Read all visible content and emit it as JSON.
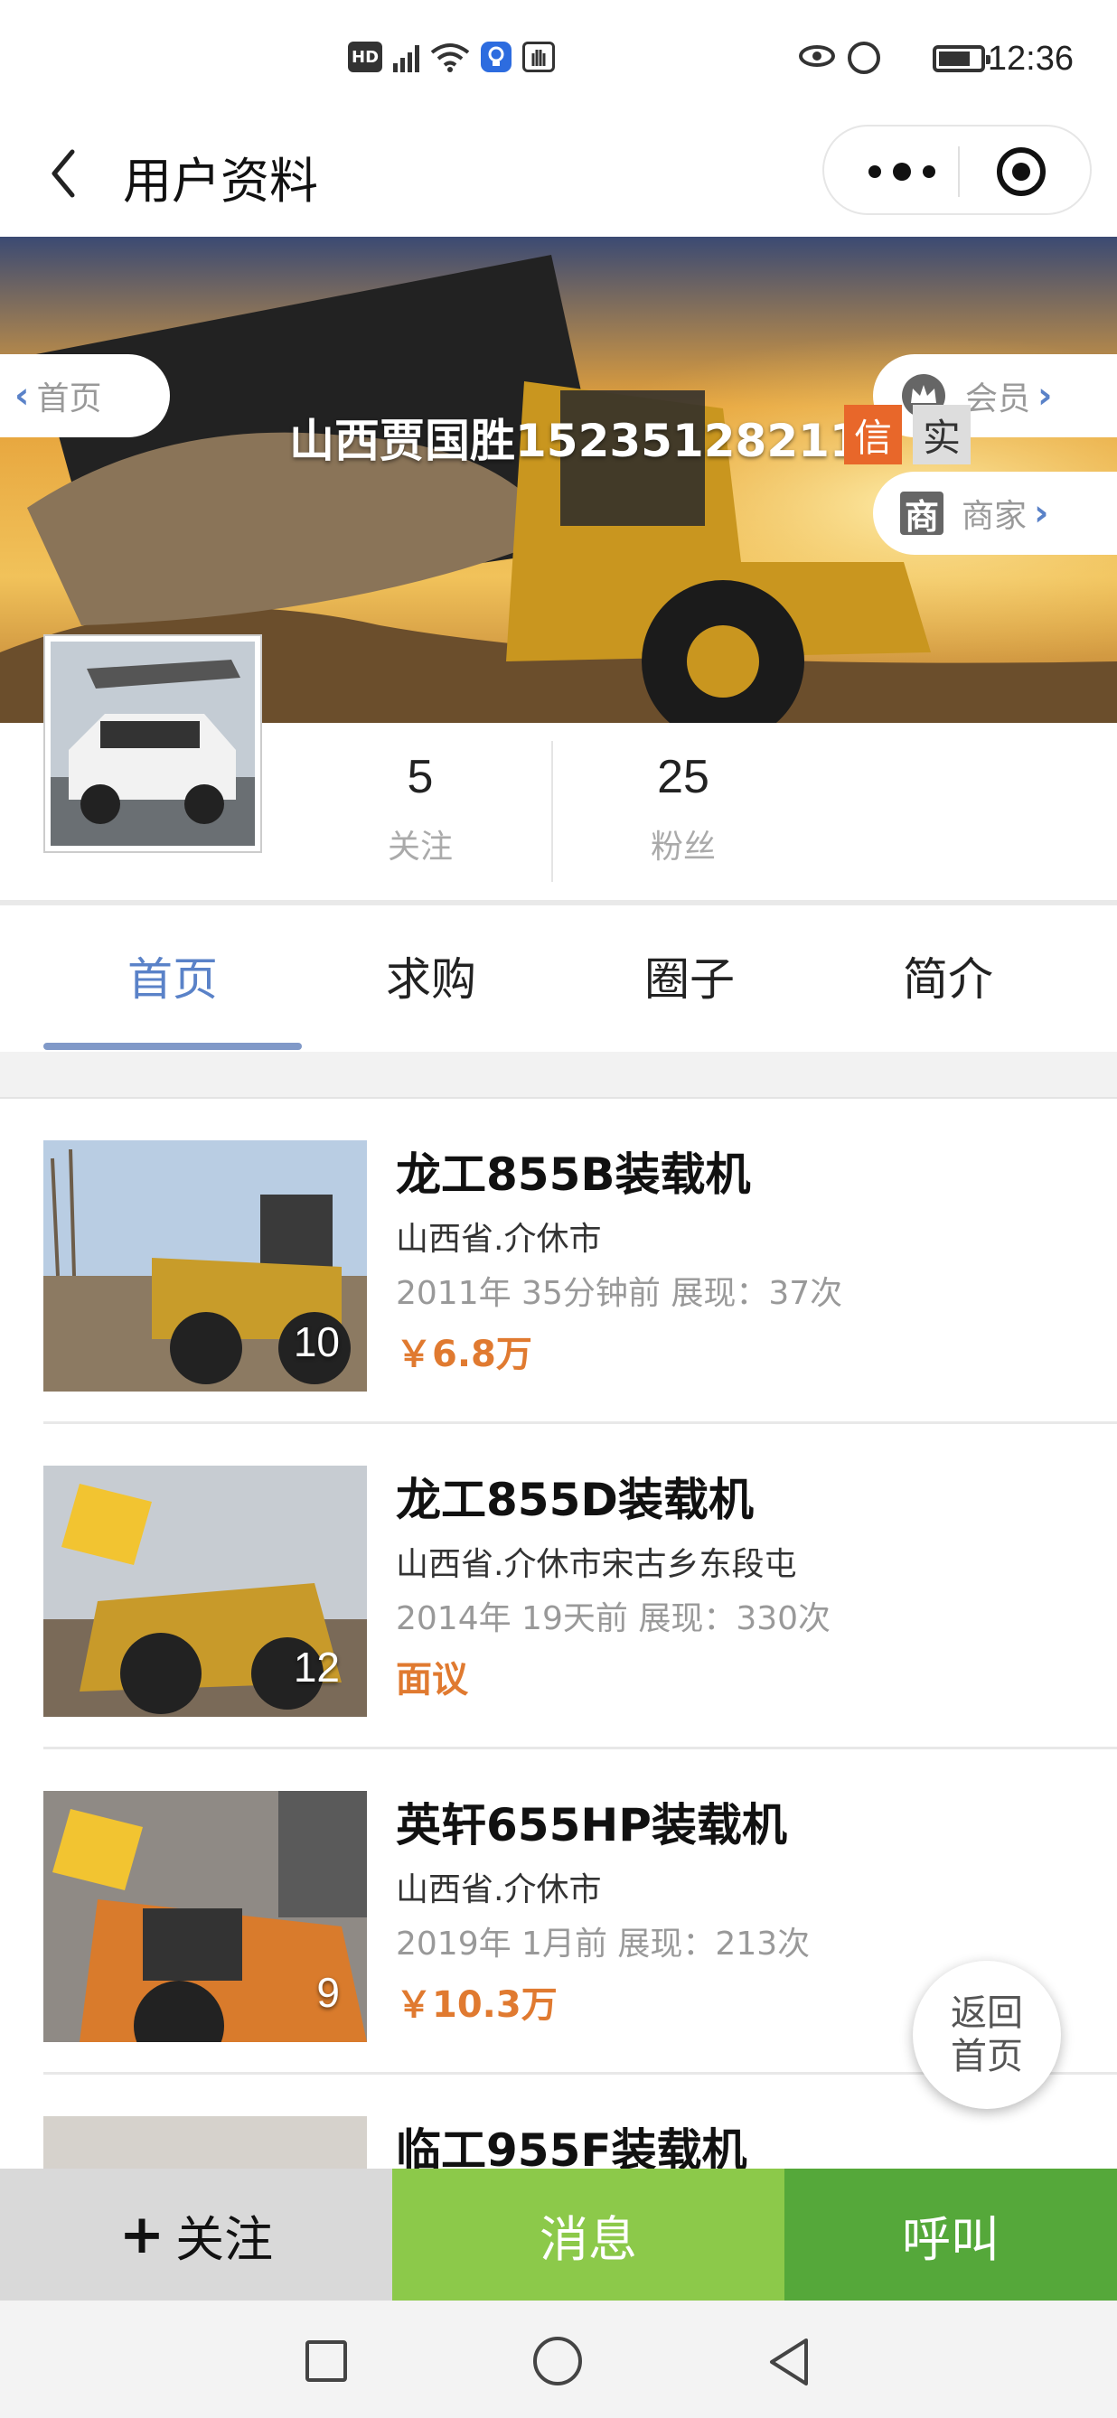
{
  "status_bar": {
    "time": "12:36",
    "left_icons": [
      "HD",
      "5G"
    ]
  },
  "title_bar": {
    "title": "用户资料"
  },
  "hero": {
    "home_link": "首页",
    "vip_link": "会员",
    "merchant_link": "商家",
    "merchant_icon_char": "商",
    "username": "山西贾国胜15235128211",
    "badge_credit": "信",
    "badge_verified": "实"
  },
  "stats": {
    "following": {
      "value": "5",
      "label": "关注"
    },
    "fans": {
      "value": "25",
      "label": "粉丝"
    }
  },
  "tabs": [
    {
      "label": "首页",
      "active": true
    },
    {
      "label": "求购",
      "active": false
    },
    {
      "label": "圈子",
      "active": false
    },
    {
      "label": "简介",
      "active": false
    }
  ],
  "listings": [
    {
      "name": "龙工855B装载机",
      "location": "山西省.介休市",
      "meta": "2011年 35分钟前   展现：37次",
      "price": "￥6.8万",
      "photo_count": "10"
    },
    {
      "name": "龙工855D装载机",
      "location": "山西省.介休市宋古乡东段屯",
      "meta": "2014年 19天前   展现：330次",
      "price": "面议",
      "photo_count": "12"
    },
    {
      "name": "英轩655HP装载机",
      "location": "山西省.介休市",
      "meta": "2019年 1月前   展现：213次",
      "price": "￥10.3万",
      "photo_count": "9"
    },
    {
      "name": "临工955F装载机",
      "location": "",
      "meta": "",
      "price": "",
      "photo_count": ""
    }
  ],
  "float_button": {
    "line1": "返回",
    "line2": "首页"
  },
  "bottom_bar": {
    "follow": "关注",
    "message": "消息",
    "call": "呼叫"
  },
  "colors": {
    "accent_blue": "#5a82c8",
    "price_orange": "#e07a30",
    "badge_orange": "#e8672a",
    "message_green": "#8cc94a",
    "call_green": "#55a83a"
  }
}
